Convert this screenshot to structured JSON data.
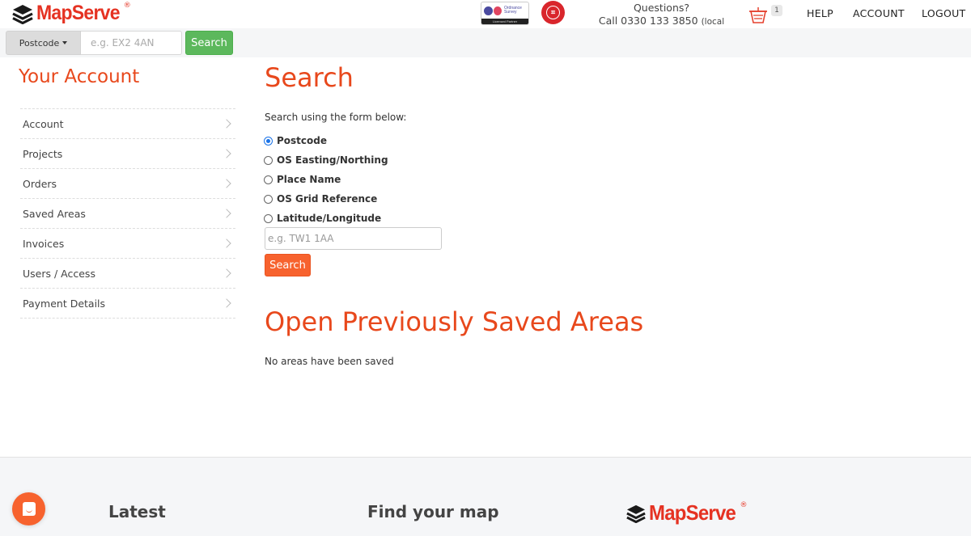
{
  "header": {
    "brand": "MapServe",
    "brand_mark": "®",
    "partner_badge": {
      "name": "Ordnance Survey",
      "line1": "Ordnance",
      "line2": "Survey",
      "subtitle": "Licensed Partner"
    },
    "seal_label": "certification-seal",
    "questions_label": "Questions?",
    "phone_prefix": "Call ",
    "phone": "0330 133 3850",
    "phone_note": "(local rate)",
    "basket_count": "1",
    "nav": [
      {
        "label": "HELP"
      },
      {
        "label": "ACCOUNT"
      },
      {
        "label": "LOGOUT"
      }
    ]
  },
  "quick_search": {
    "type_selected": "Postcode",
    "placeholder": "e.g. EX2 4AN",
    "value": "",
    "button_label": "Search"
  },
  "sidebar": {
    "title": "Your Account",
    "items": [
      {
        "label": "Account"
      },
      {
        "label": "Projects"
      },
      {
        "label": "Orders"
      },
      {
        "label": "Saved Areas"
      },
      {
        "label": "Invoices"
      },
      {
        "label": "Users / Access"
      },
      {
        "label": "Payment Details"
      }
    ]
  },
  "search": {
    "title": "Search",
    "intro": "Search using the form below:",
    "options": [
      {
        "label": "Postcode",
        "checked": true
      },
      {
        "label": "OS Easting/Northing",
        "checked": false
      },
      {
        "label": "Place Name",
        "checked": false
      },
      {
        "label": "OS Grid Reference",
        "checked": false
      },
      {
        "label": "Latitude/Longitude",
        "checked": false
      }
    ],
    "placeholder": "e.g. TW1 1AA",
    "value": "",
    "button_label": "Search"
  },
  "saved_areas": {
    "title": "Open Previously Saved Areas",
    "empty_message": "No areas have been saved"
  },
  "footer": {
    "headings": [
      {
        "label": "Latest"
      },
      {
        "label": "Find your map"
      }
    ],
    "brand": "MapServe",
    "brand_mark": "®"
  },
  "colors": {
    "brand_red": "#e53222",
    "heading_orange": "#e8481c",
    "action_orange": "#f7622e",
    "search_green": "#5cb85c",
    "radio_blue": "#1a73e8"
  }
}
